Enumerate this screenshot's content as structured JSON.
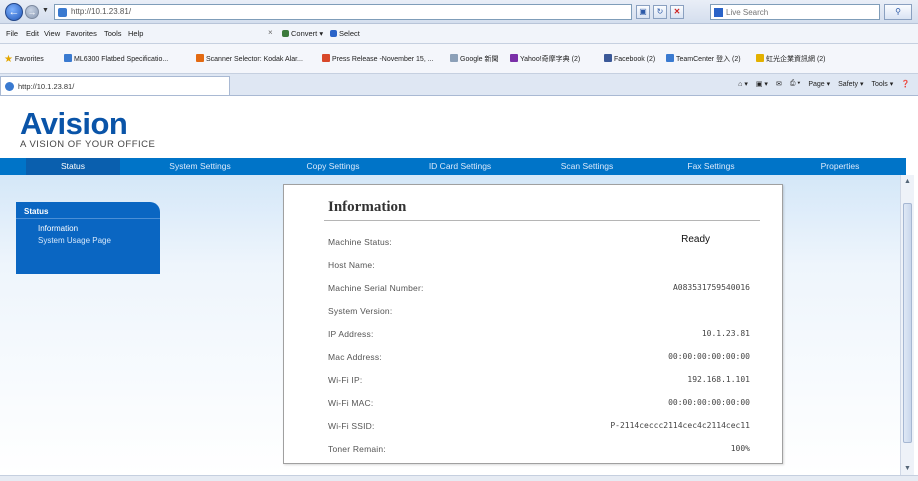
{
  "browser": {
    "url": "http://10.1.23.81/",
    "search_placeholder": "Live Search",
    "menu": [
      "File",
      "Edit",
      "View",
      "Favorites",
      "Tools",
      "Help"
    ],
    "toolbar_items": [
      "Convert",
      "Select"
    ],
    "favorites_label": "Favorites",
    "favorites": [
      "ML6300 Flatbed Specificatio...",
      "Scanner Selector: Kodak Alar...",
      "Press Release -November 15, ...",
      "Google 新聞",
      "Yahoo!奇摩字典 (2)",
      "Facebook (2)",
      "TeamCenter 登入 (2)",
      "虹光企業資訊網 (2)"
    ],
    "tab_title": "http://10.1.23.81/",
    "command_bar": [
      "Page",
      "Safety",
      "Tools"
    ]
  },
  "brand": {
    "name": "Avision",
    "tagline": "A VISION OF YOUR OFFICE",
    "color": "#0a54a8"
  },
  "nav": [
    {
      "label": "Status",
      "active": true
    },
    {
      "label": "System Settings",
      "active": false
    },
    {
      "label": "Copy Settings",
      "active": false
    },
    {
      "label": "ID Card Settings",
      "active": false
    },
    {
      "label": "Scan Settings",
      "active": false
    },
    {
      "label": "Fax Settings",
      "active": false
    },
    {
      "label": "Properties",
      "active": false
    }
  ],
  "sidebar": {
    "title": "Status",
    "items": [
      {
        "label": "Information",
        "current": true
      },
      {
        "label": "System Usage Page",
        "current": false
      }
    ]
  },
  "info": {
    "title": "Information",
    "rows": [
      {
        "label": "Machine Status:",
        "value": "Ready"
      },
      {
        "label": "Host Name:",
        "value": ""
      },
      {
        "label": "Machine Serial Number:",
        "value": "A083531759540016"
      },
      {
        "label": "System Version:",
        "value": ""
      },
      {
        "label": "IP Address:",
        "value": "10.1.23.81"
      },
      {
        "label": "Mac Address:",
        "value": "00:00:00:00:00:00"
      },
      {
        "label": "Wi-Fi IP:",
        "value": "192.168.1.101"
      },
      {
        "label": "Wi-Fi MAC:",
        "value": "00:00:00:00:00:00"
      },
      {
        "label": "Wi-Fi SSID:",
        "value": "P-2114ceccc2114cec4c2114cec11"
      },
      {
        "label": "Toner Remain:",
        "value": "100%"
      }
    ]
  }
}
